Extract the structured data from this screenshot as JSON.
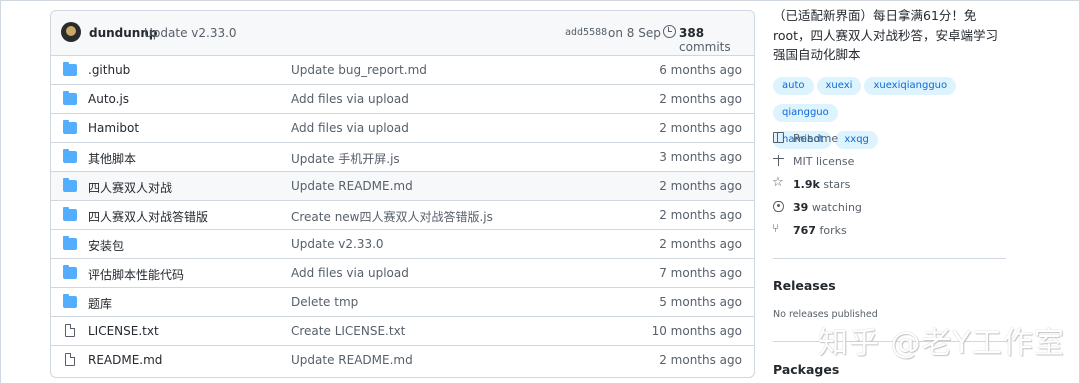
{
  "commit": {
    "author": "dundunnp",
    "message": "Update v2.33.0",
    "hash": "add5588",
    "date": "on 8 Sep",
    "count": "388",
    "count_label": "commits"
  },
  "files": [
    {
      "type": "folder",
      "name": ".github",
      "message": "Update bug_report.md",
      "age": "6 months ago"
    },
    {
      "type": "folder",
      "name": "Auto.js",
      "message": "Add files via upload",
      "age": "2 months ago"
    },
    {
      "type": "folder",
      "name": "Hamibot",
      "message": "Add files via upload",
      "age": "2 months ago"
    },
    {
      "type": "folder",
      "name": "其他脚本",
      "message": "Update 手机开屏.js",
      "age": "3 months ago"
    },
    {
      "type": "folder",
      "name": "四人赛双人对战",
      "message": "Update README.md",
      "age": "2 months ago"
    },
    {
      "type": "folder",
      "name": "四人赛双人对战答错版",
      "message": "Create new四人赛双人对战答错版.js",
      "age": "2 months ago"
    },
    {
      "type": "folder",
      "name": "安装包",
      "message": "Update v2.33.0",
      "age": "2 months ago"
    },
    {
      "type": "folder",
      "name": "评估脚本性能代码",
      "message": "Add files via upload",
      "age": "7 months ago"
    },
    {
      "type": "folder",
      "name": "题库",
      "message": "Delete tmp",
      "age": "5 months ago"
    },
    {
      "type": "file",
      "name": "LICENSE.txt",
      "message": "Create LICENSE.txt",
      "age": "10 months ago"
    },
    {
      "type": "file",
      "name": "README.md",
      "message": "Update README.md",
      "age": "2 months ago"
    }
  ],
  "about": {
    "line1": "（已适配新界面）每日拿满61分！免",
    "line2": "root，四人赛双人对战秒答，安卓端学习",
    "line3": "强国自动化脚本"
  },
  "topics": [
    "auto",
    "xuexi",
    "xuexiqiangguo",
    "qiangguo",
    "hamibot",
    "xxqg"
  ],
  "meta": {
    "readme": "Readme",
    "license": "MIT license",
    "stars_count": "1.9k",
    "stars_label": "stars",
    "watching_count": "39",
    "watching_label": "watching",
    "forks_count": "767",
    "forks_label": "forks"
  },
  "releases": {
    "title": "Releases",
    "note": "No releases published"
  },
  "packages": {
    "title": "Packages"
  },
  "watermark": "知乎 @老Y工作室"
}
